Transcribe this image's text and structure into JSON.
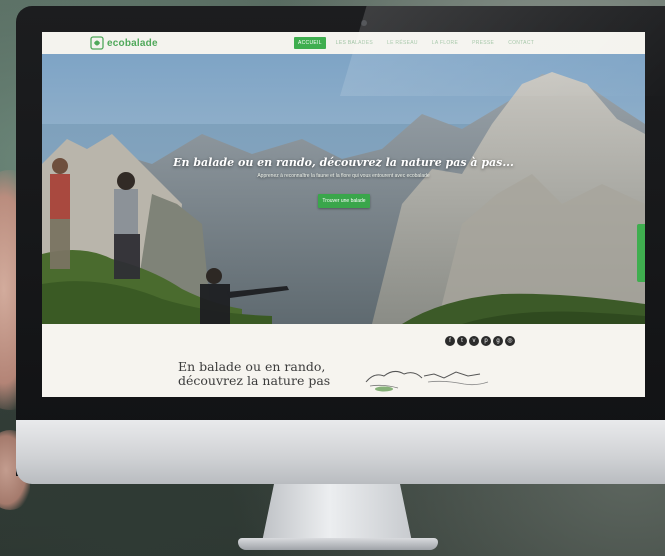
{
  "site": {
    "logo_text": "ecobalade",
    "nav": [
      {
        "label": "Accueil",
        "active": true
      },
      {
        "label": "Les balades",
        "active": false
      },
      {
        "label": "Le réseau",
        "active": false
      },
      {
        "label": "La flore",
        "active": false
      },
      {
        "label": "Presse",
        "active": false
      },
      {
        "label": "Contact",
        "active": false
      }
    ],
    "hero": {
      "title": "En balade ou en rando, découvrez la nature pas à pas...",
      "subtitle": "Apprenez à reconnaître la faune et la flore qui vous entourent avec ecobalade",
      "cta_label": "Trouver une balade"
    },
    "social_icons": [
      "facebook-icon",
      "twitter-icon",
      "vimeo-icon",
      "pinterest-icon",
      "google-plus-icon",
      "instagram-icon"
    ],
    "social_glyphs": [
      "f",
      "t",
      "v",
      "p",
      "g",
      "◎"
    ],
    "headline": "En balade ou en rando, découvrez la nature pas",
    "colors": {
      "accent": "#3fae4f",
      "logo": "#4fa85a",
      "background": "#f6f4ef"
    }
  }
}
